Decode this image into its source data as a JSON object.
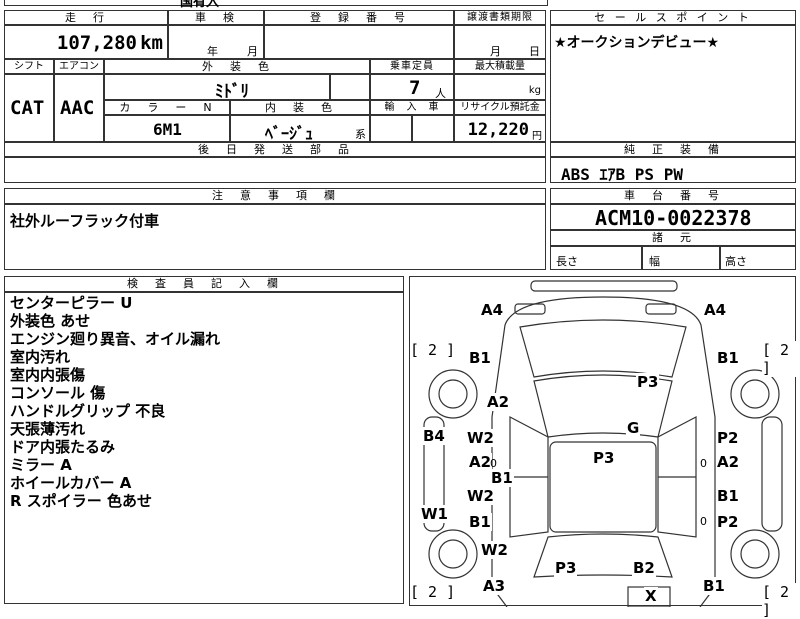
{
  "top_strip": {
    "partial_text": "国有入"
  },
  "mileage": {
    "label": "走　行",
    "value": "107,280",
    "unit": "km"
  },
  "inspection": {
    "label": "車　検",
    "year_unit": "年",
    "month_unit": "月"
  },
  "registration": {
    "label": "登　録　番　号"
  },
  "transfer_deadline": {
    "label": "譲渡書類期限",
    "month_unit": "月",
    "day_unit": "日"
  },
  "sales_point": {
    "label": "セ ー ル ス ポ イ ン ト",
    "text": "★オークションデビュー★"
  },
  "shift": {
    "label": "シフト",
    "value": "CAT"
  },
  "aircon": {
    "label": "エアコン",
    "value": "AAC"
  },
  "exterior_color": {
    "label": "外　装　色",
    "value": "ﾐﾄﾞﾘ"
  },
  "capacity": {
    "label": "乗車定員",
    "value": "7",
    "unit": "人"
  },
  "max_load": {
    "label": "最大積載量",
    "unit": "kg"
  },
  "color_no": {
    "label": "カ　ラ　ー　N　o.",
    "value": "6M1"
  },
  "interior_color": {
    "label": "内　装　色",
    "value": "ﾍﾞｰｼﾞｭ",
    "suffix": "系"
  },
  "import_car": {
    "label": "輸　入　車"
  },
  "recycle_fee": {
    "label": "リサイクル預託金",
    "value": "12,220",
    "unit": "円"
  },
  "later_parts": {
    "label": "後　日　発　送　部　品"
  },
  "genuine_equipment": {
    "label": "純　正　装　備",
    "value": "ABS ｴｱB PS PW"
  },
  "caution": {
    "label": "注　意　事　項　欄",
    "text": "社外ルーフラック付車"
  },
  "chassis_number": {
    "label": "車　台　番　号",
    "value": "ACM10-0022378"
  },
  "dimensions": {
    "label": "諸　元",
    "length_label": "長さ",
    "width_label": "幅",
    "height_label": "高さ"
  },
  "inspector": {
    "label": "検　査　員　記　入　欄",
    "notes": [
      "センターピラー U",
      "外装色 あせ",
      "エンジン廻り異音、オイル漏れ",
      "室内汚れ",
      "室内内張傷",
      "コンソール 傷",
      "ハンドルグリップ 不良",
      "天張薄汚れ",
      "ドア内張たるみ",
      "ミラー A",
      "ホイールカバー A",
      "R スポイラー 色あせ"
    ]
  },
  "damage_map": {
    "marks": [
      "A4",
      "A4",
      "B1",
      "B1",
      "P3",
      "A2",
      "G",
      "B4",
      "W2",
      "P2",
      "P3",
      "A2",
      "A2",
      "B1",
      "W2",
      "B1",
      "W1",
      "B1",
      "P2",
      "W2",
      "P3",
      "B2",
      "A3",
      "B1",
      "X"
    ],
    "brackets": [
      "[ 2 ]",
      "[ 2 ]",
      "[ 2 ]",
      "[ 2 ]"
    ],
    "small_marks": [
      "0",
      "0",
      "0"
    ]
  }
}
